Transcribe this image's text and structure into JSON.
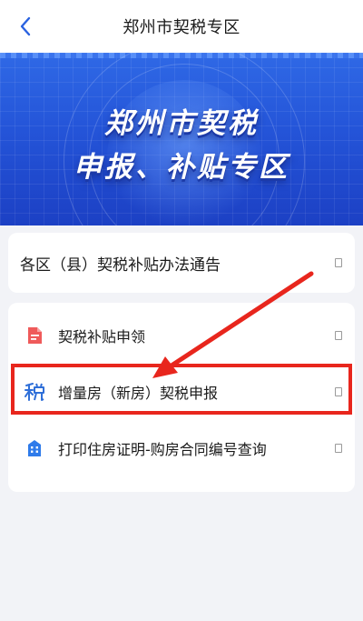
{
  "header": {
    "title": "郑州市契税专区"
  },
  "banner": {
    "line1": "郑州市契税",
    "line2": "申报、补贴专区"
  },
  "notice": {
    "label": "各区（县）契税补贴办法通告"
  },
  "menu": {
    "items": [
      {
        "label": "契税补贴申领",
        "icon": "document-red-icon"
      },
      {
        "label": "增量房（新房）契税申报",
        "icon": "tax-character-icon"
      },
      {
        "label": "打印住房证明-购房合同编号查询",
        "icon": "building-icon"
      }
    ]
  },
  "colors": {
    "accent_blue": "#2a62e0",
    "highlight_red": "#e8261d",
    "doc_icon_red": "#ef5a5a",
    "building_icon_blue": "#2f7bea"
  }
}
